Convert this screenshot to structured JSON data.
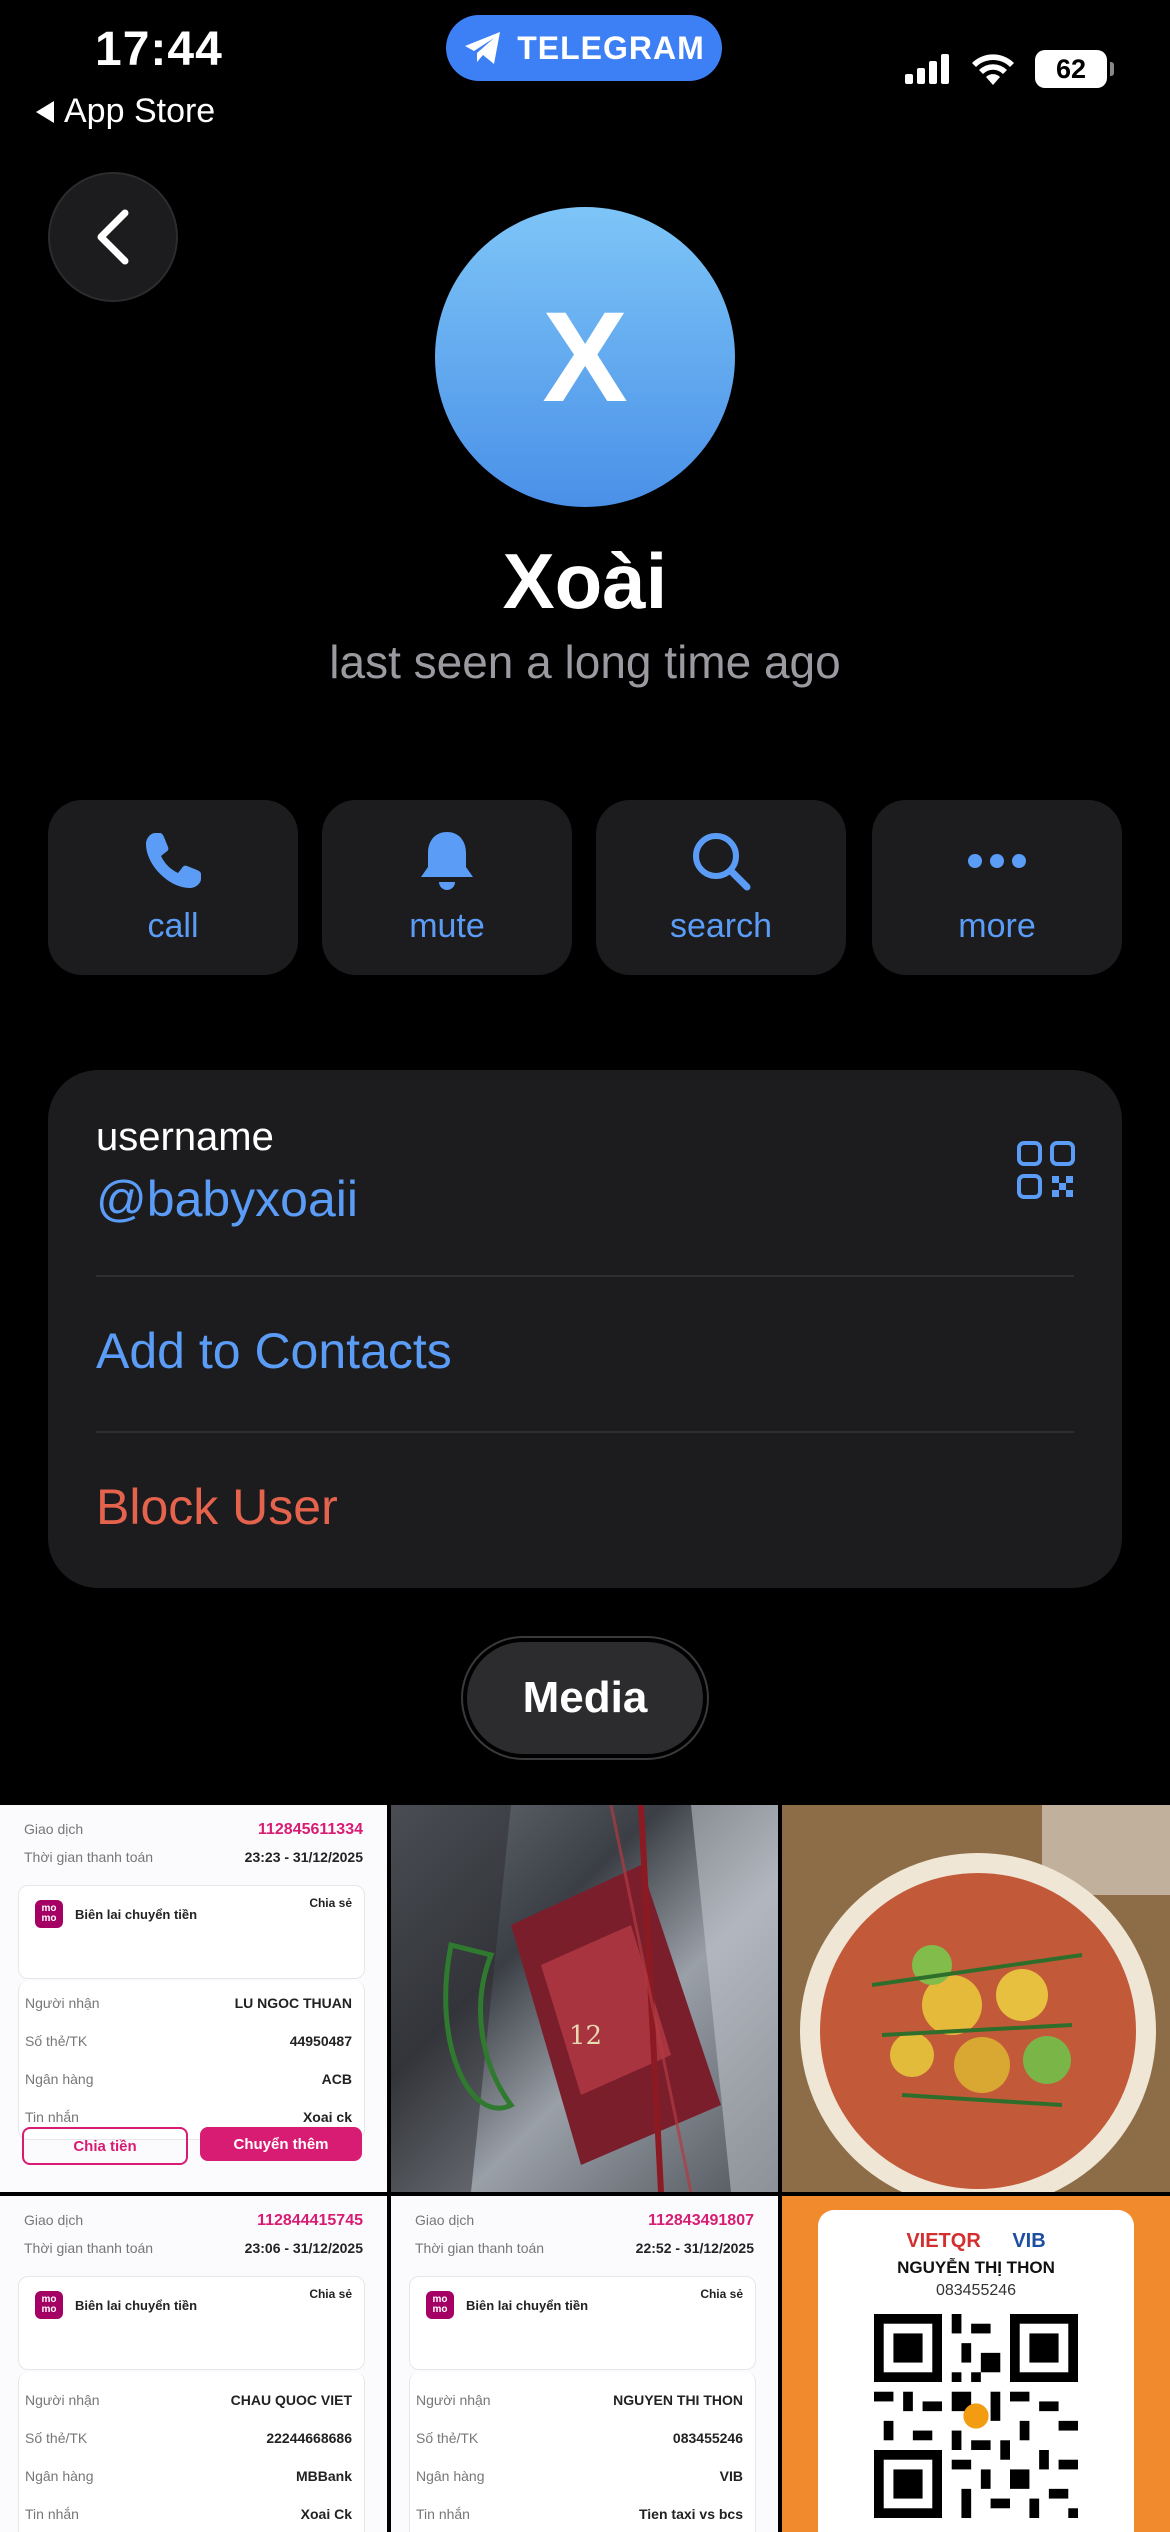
{
  "status_bar": {
    "time": "17:44",
    "back_app": "App Store",
    "pill_label": "TELEGRAM",
    "battery": "62"
  },
  "profile": {
    "avatar_letter": "X",
    "name": "Xoài",
    "status": "last seen a long time ago"
  },
  "actions": [
    {
      "label": "call",
      "icon": "phone-icon"
    },
    {
      "label": "mute",
      "icon": "bell-icon"
    },
    {
      "label": "search",
      "icon": "search-icon"
    },
    {
      "label": "more",
      "icon": "ellipsis-icon"
    }
  ],
  "info": {
    "username_label": "username",
    "username_value": "@babyxoaii",
    "add_contacts": "Add to Contacts",
    "block_user": "Block User"
  },
  "media_tab": "Media",
  "colors": {
    "accent": "#5b9cf6",
    "danger": "#e5634d",
    "card": "#1c1c1e",
    "background": "#000000",
    "momo_pink": "#d81b73"
  },
  "media": {
    "receipt1": {
      "label_tx": "Giao dịch",
      "tx_id": "112845611334",
      "label_time": "Thời gian thanh toán",
      "time": "23:23 - 31/12/2025",
      "title": "Biên lai chuyển tiền",
      "share": "Chia sẻ",
      "label_receiver": "Người nhận",
      "receiver": "LU NGOC THUAN",
      "label_account": "Số thẻ/TK",
      "account": "44950487",
      "label_bank": "Ngân hàng",
      "bank": "ACB",
      "label_message": "Tin nhắn",
      "message": "Xoai ck",
      "btn_split": "Chia tiền",
      "btn_transfer": "Chuyển thêm"
    },
    "receipt2": {
      "label_tx": "Giao dịch",
      "tx_id": "112844415745",
      "label_time": "Thời gian thanh toán",
      "time": "23:06 - 31/12/2025",
      "title": "Biên lai chuyển tiền",
      "share": "Chia sẻ",
      "label_receiver": "Người nhận",
      "receiver": "CHAU QUOC VIET",
      "label_account": "Số thẻ/TK",
      "account": "22244668686",
      "label_bank": "Ngân hàng",
      "bank": "MBBank",
      "label_message": "Tin nhắn",
      "message": "Xoai Ck"
    },
    "receipt3": {
      "label_tx": "Giao dịch",
      "tx_id": "112843491807",
      "label_time": "Thời gian thanh toán",
      "time": "22:52 - 31/12/2025",
      "title": "Biên lai chuyển tiền",
      "share": "Chia sẻ",
      "label_receiver": "Người nhận",
      "receiver": "NGUYEN THI THON",
      "label_account": "Số thẻ/TK",
      "account": "083455246",
      "label_bank": "Ngân hàng",
      "bank": "VIB",
      "label_message": "Tin nhắn",
      "message": "Tien taxi vs bcs"
    },
    "momo_logo": "mo mo",
    "bottle_label": "12",
    "qr_card": {
      "brand_left": "VIETQR",
      "brand_right": "VIB",
      "name": "NGUYỄN THỊ THON",
      "number": "083455246"
    }
  }
}
